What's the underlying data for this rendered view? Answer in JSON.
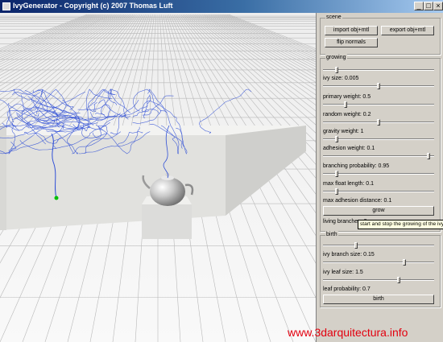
{
  "window": {
    "title": "IvyGenerator  -  Copyright (c) 2007 Thomas Luft",
    "minimize": "_",
    "maximize": "□",
    "close": "×"
  },
  "scene": {
    "title": "scene",
    "import_label": "import obj+mtl",
    "export_label": "export obj+mtl",
    "flip_label": "flip normals"
  },
  "growing": {
    "title": "growing",
    "top_slider": 0.12,
    "ivy_size": {
      "label": "ivy size: 0.005",
      "level": 0.5
    },
    "primary_weight": {
      "label": "primary weight: 0.5",
      "level": 0.2
    },
    "random_weight": {
      "label": "random weight: 0.2",
      "level": 0.5
    },
    "gravity_weight": {
      "label": "gravity weight: 1",
      "level": 0.12
    },
    "adhesion_weight": {
      "label": "adhesion weight: 0.1",
      "level": 0.95
    },
    "branching_probability": {
      "label": "branching probability: 0.95",
      "level": 0.12
    },
    "max_float_length": {
      "label": "max float length: 0.1",
      "level": 0.12
    },
    "max_adhesion_distance": {
      "label": "max adhesion distance: 0.1"
    },
    "grow_label": "grow",
    "living_branches_label": "living branches: 0",
    "tooltip": "start and stop the growing of the ivy"
  },
  "birth": {
    "title": "birth",
    "top_slider": 0.3,
    "branch_size": {
      "label": "ivy branch size: 0.15",
      "level": 0.73
    },
    "leaf_size": {
      "label": "ivy leaf size: 1.5",
      "level": 0.68
    },
    "leaf_probability": {
      "label": "leaf probability: 0.7"
    },
    "birth_label": "birth"
  },
  "watermark": "www.3darquitectura.info",
  "colors": {
    "ivy": "#2f4fd6",
    "root": "#00c000",
    "panel": "#d4d0c8",
    "grid": "#b9b9b9",
    "wall": "#e1e1de"
  }
}
